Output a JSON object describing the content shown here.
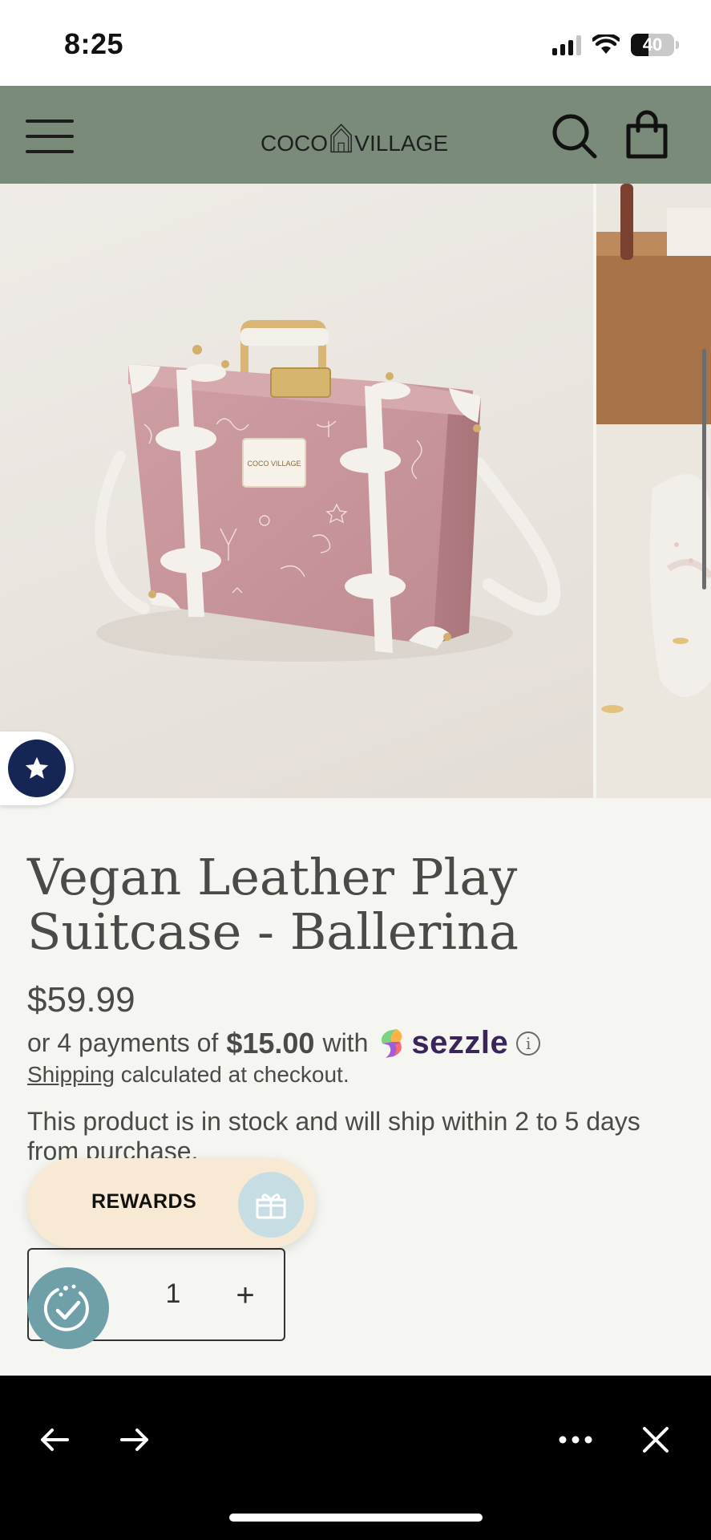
{
  "status_bar": {
    "time": "8:25",
    "battery": "40",
    "battery_level": 0.4,
    "icons": [
      "cellular-signal-icon",
      "wifi-icon",
      "battery-icon"
    ]
  },
  "header": {
    "brand_left": "COCO",
    "brand_right": "VILLAGE",
    "background_color": "#7a8b7a",
    "icons": [
      "hamburger-menu-icon",
      "search-icon",
      "shopping-bag-icon"
    ]
  },
  "product": {
    "title": "Vegan Leather Play Suitcase - Ballerina",
    "price": "$59.99",
    "installments": {
      "prefix": "or 4 payments of",
      "amount": "$15.00",
      "suffix": "with",
      "provider": "sezzle"
    },
    "shipping_link": "Shipping",
    "shipping_rest": " calculated at checkout.",
    "stock_message": "This product is in stock and will ship within 2 to 5 days from purchase.",
    "quantity": "1",
    "plus_label": "+",
    "badge_text": "COCO VILLAGE"
  },
  "rewards": {
    "label": "REWARDS"
  },
  "colors": {
    "case_pink": "#c9979b",
    "trim_white": "#f4f1ec",
    "reviews_navy": "#152655",
    "rewards_bg": "#f7e9d3",
    "cookie_teal": "#6fa0a9",
    "sezzle_purple": "#392558"
  }
}
